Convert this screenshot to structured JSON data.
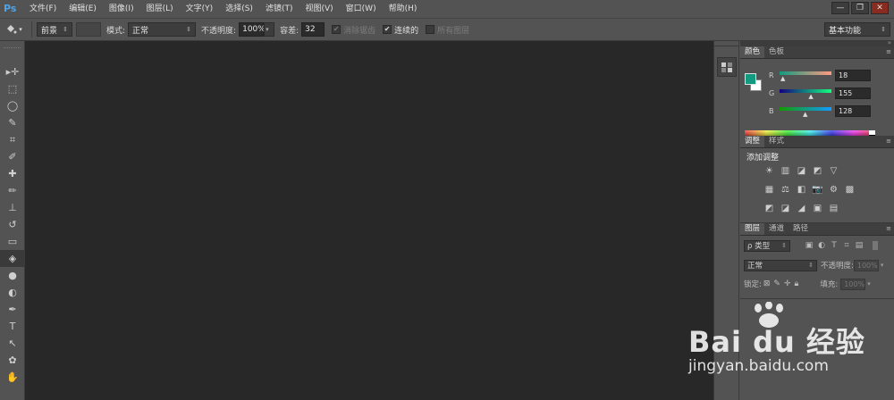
{
  "app": {
    "logo": "Ps"
  },
  "menu": [
    "文件(F)",
    "编辑(E)",
    "图像(I)",
    "图层(L)",
    "文字(Y)",
    "选择(S)",
    "滤镜(T)",
    "视图(V)",
    "窗口(W)",
    "帮助(H)"
  ],
  "window_controls": {
    "minimize": "—",
    "restore": "❐",
    "close": "✕"
  },
  "options": {
    "fill_source": "前景",
    "mode_label": "模式:",
    "mode_value": "正常",
    "opacity_label": "不透明度:",
    "opacity_value": "100%",
    "tolerance_label": "容差:",
    "tolerance_value": "32",
    "anti_alias_label": "消除锯齿",
    "contiguous_label": "连续的",
    "all_layers_label": "所有图层",
    "workspace": "基本功能"
  },
  "tools": [
    "move",
    "marquee",
    "lasso",
    "quick-select",
    "crop",
    "eyedropper",
    "healing",
    "brush",
    "clone-stamp",
    "history-brush",
    "eraser",
    "paint-bucket",
    "blur",
    "dodge",
    "pen",
    "type",
    "path-select",
    "shape",
    "hand"
  ],
  "tool_glyphs": [
    "▸✛",
    "⬚",
    "◯",
    "✎",
    "⌗",
    "✐",
    "✚",
    "✏",
    "⊥",
    "↺",
    "▭",
    "◈",
    "●",
    "◐",
    "✒",
    "T",
    "↖",
    "✿",
    "✋"
  ],
  "active_tool": "paint-bucket",
  "color_panel": {
    "tabs": [
      "颜色",
      "色板"
    ],
    "foreground": "#129b80",
    "background": "#ffffff",
    "channels": [
      {
        "label": "R",
        "value": "18",
        "fraction": 0.07
      },
      {
        "label": "G",
        "value": "155",
        "fraction": 0.61
      },
      {
        "label": "B",
        "value": "128",
        "fraction": 0.5
      }
    ]
  },
  "adjustments_panel": {
    "tabs": [
      "调整",
      "样式"
    ],
    "title": "添加调整",
    "rows": [
      [
        "☀",
        "▥",
        "◪",
        "◩",
        "▽"
      ],
      [
        "▦",
        "⚖",
        "◧",
        "📷",
        "⚙",
        "▩"
      ],
      [
        "◩",
        "◪",
        "◢",
        "▣",
        "▤"
      ]
    ]
  },
  "layers_panel": {
    "tabs": [
      "图层",
      "通道",
      "路径"
    ],
    "filter_label": "ρ 类型",
    "blend_mode": "正常",
    "opacity_label": "不透明度:",
    "opacity_value": "100%",
    "lock_label": "锁定:",
    "fill_label": "填充:",
    "fill_value": "100%"
  },
  "watermark": {
    "brand": "Bai  du 经验",
    "url": "jingyan.baidu.com"
  }
}
